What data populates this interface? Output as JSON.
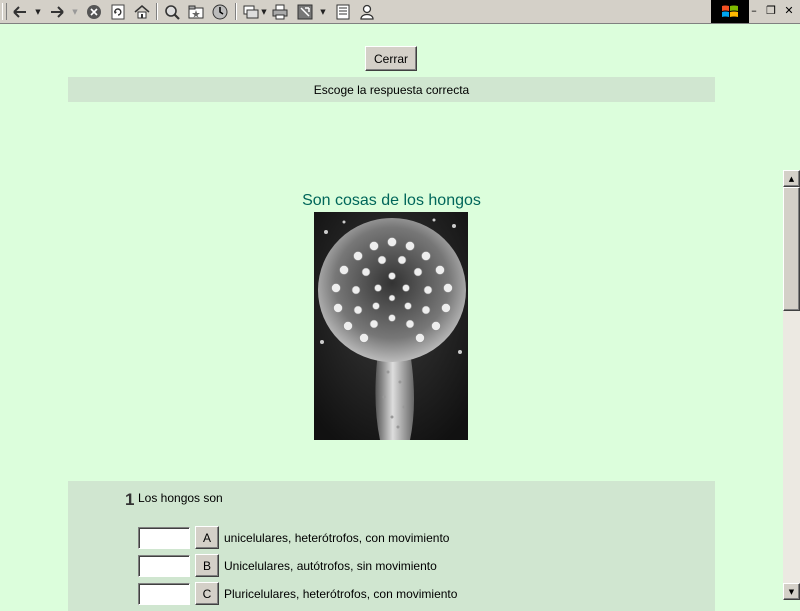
{
  "toolbar": {
    "buttons": [
      "back-icon",
      "forward-icon",
      "stop-icon",
      "refresh-icon",
      "home-icon",
      "search-icon",
      "favorites-icon",
      "history-icon",
      "mail-icon",
      "print-icon",
      "fullscreen-icon",
      "edit-icon",
      "messenger-icon"
    ],
    "window_controls": {
      "minimize": "–",
      "restore": "❐",
      "close": "✕"
    }
  },
  "page": {
    "close_button": "Cerrar",
    "instruction": "Escoge la respuesta correcta",
    "title": "Son cosas de los hongos",
    "accent_color": "#00665a",
    "background_color": "#dcfedc",
    "panel_color": "#d0e6d0"
  },
  "question": {
    "number": "1",
    "text": "Los hongos son",
    "options": [
      {
        "letter": "A",
        "text": "unicelulares, heterótrofos, con movimiento",
        "value": ""
      },
      {
        "letter": "B",
        "text": "Unicelulares, autótrofos, sin movimiento",
        "value": ""
      },
      {
        "letter": "C",
        "text": "Pluricelulares, heterótrofos, con movimiento",
        "value": ""
      }
    ]
  }
}
